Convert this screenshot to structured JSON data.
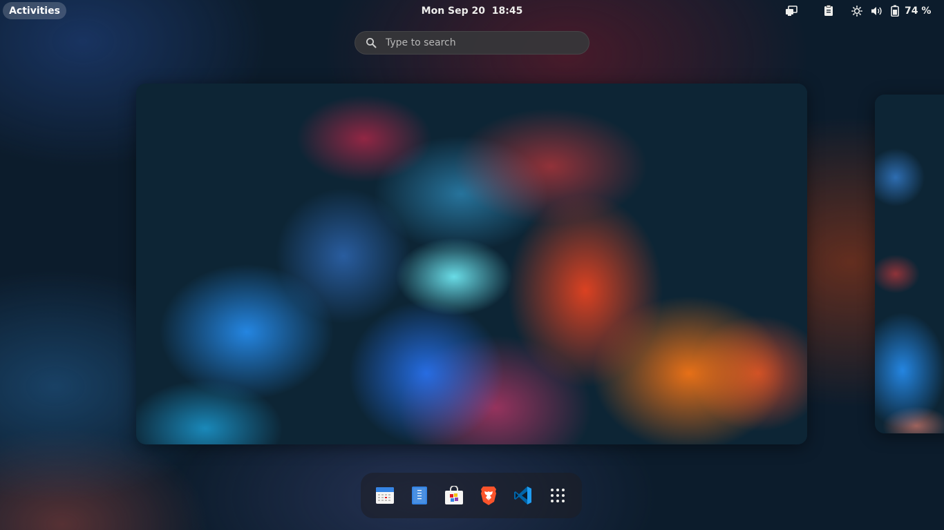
{
  "topbar": {
    "activities_label": "Activities",
    "clock": "Mon Sep 20  18:45",
    "battery_percent": "74 %"
  },
  "search": {
    "placeholder": "Type to search"
  },
  "dock": {
    "items": [
      {
        "name": "calendar"
      },
      {
        "name": "text-editor"
      },
      {
        "name": "software-center"
      },
      {
        "name": "brave-browser"
      },
      {
        "name": "visual-studio-code"
      },
      {
        "name": "show-applications"
      }
    ]
  },
  "colors": {
    "topbar_text": "#eeeeec",
    "search_bg": "#36363a",
    "brave_orange": "#fb542b",
    "vscode_blue": "#0078d4"
  }
}
